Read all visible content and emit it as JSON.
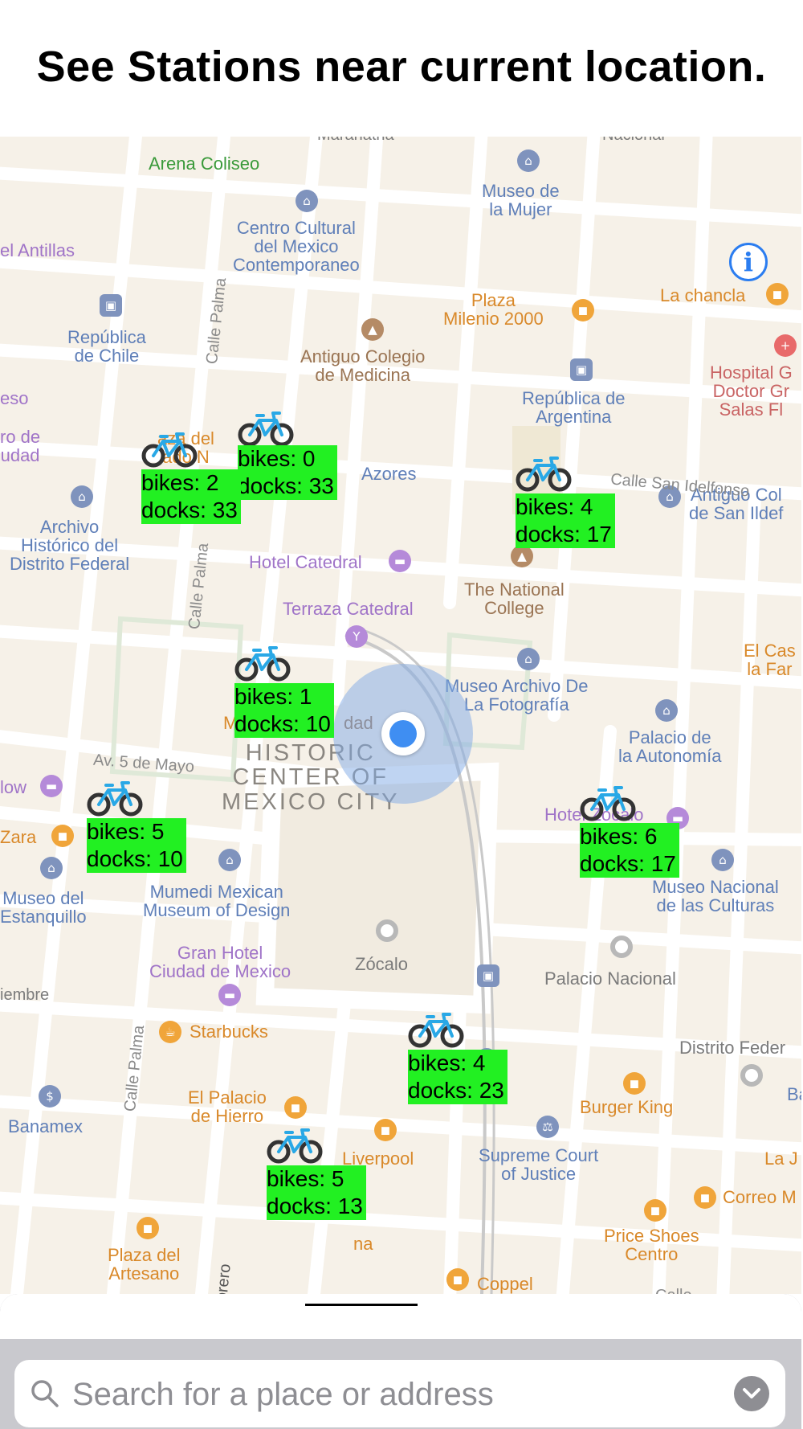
{
  "header": {
    "title": "See Stations near current location."
  },
  "map": {
    "district_label": "HISTORIC\nCENTER OF\nMEXICO CITY",
    "places": {
      "arena_coliseo": "Arena Coliseo",
      "museo_mujer": "Museo de\nla Mujer",
      "centro_cultural": "Centro Cultural\ndel Mexico\nContemporaneo",
      "el_antillas": "el Antillas",
      "la_chancla": "La chancla",
      "plaza_milenio": "Plaza\nMilenio 2000",
      "republica_chile": "República\nde Chile",
      "antiguo_colegio": "Antiguo Colegio\nde Medicina",
      "hospital": "Hospital G\nDoctor Gr\nSalas Fl",
      "republica_argentina": "República de\nArgentina",
      "eso": "eso",
      "ro_de_udad": "ro de\nudad",
      "plaza_del": "aza del\nado N",
      "azores": "Azores",
      "archivo_historico": "Archivo\nHistórico del\nDistrito Federal",
      "hotel_catedral": "Hotel Catedral",
      "national_college": "The National\nCollege",
      "antiguo_col_san": "Antiguo Col\nde San Ildef",
      "terraza_catedral": "Terraza Catedral",
      "el_cas": "El Cas\nla Far",
      "museo_fotografia": "Museo Archivo De\nLa Fotografía",
      "dad": "dad",
      "m": "M",
      "palacio_autonomia": "Palacio de\nla Autonomía",
      "low": "low",
      "zara": "Zara",
      "hotel_zocalo": "Hotel Zocalo",
      "museo_culturas": "Museo Nacional\nde las Culturas",
      "museo_estanquillo": "Museo del\nEstanquillo",
      "mumedi": "Mumedi Mexican\nMuseum of Design",
      "gran_hotel": "Gran Hotel\nCiudad de Mexico",
      "zocalo": "Zócalo",
      "palacio_nacional": "Palacio Nacional",
      "iembre": "iembre",
      "starbucks": "Starbucks",
      "distrito_feder": "Distrito Feder",
      "banamex": "Banamex",
      "el_palacio_hierro": "El Palacio\nde Hierro",
      "burger_king": "Burger King",
      "ba": "Ba",
      "liverpool": "Liverpool",
      "supreme_court": "Supreme Court\nof Justice",
      "la_j": "La J",
      "correo": "Correo M",
      "price_shoes": "Price Shoes\nCentro",
      "plaza_artesano": "Plaza del\nArtesano",
      "coppel": "Coppel",
      "na": "na",
      "maranatha": "Maranatha",
      "nacional": "Nacional"
    },
    "streets": {
      "calle_palma_1": "Calle Palma",
      "calle_palma_2": "Calle Palma",
      "calle_palma_3": "Calle Palma",
      "av_5_mayo": "Av. 5 de Mayo",
      "san_idelfonso": "Calle San Idelfonso",
      "obrero": "orero",
      "calle": "Calle"
    }
  },
  "stations": [
    {
      "bikes": "bikes: 0",
      "docks": "docks: 33"
    },
    {
      "bikes": "bikes: 2",
      "docks": "docks: 33"
    },
    {
      "bikes": "bikes: 4",
      "docks": "docks: 17"
    },
    {
      "bikes": "bikes: 1",
      "docks": "docks: 10"
    },
    {
      "bikes": "bikes: 5",
      "docks": "docks: 10"
    },
    {
      "bikes": "bikes: 6",
      "docks": "docks: 17"
    },
    {
      "bikes": "bikes: 4",
      "docks": "docks: 23"
    },
    {
      "bikes": "bikes: 5",
      "docks": "docks: 13"
    }
  ],
  "controls": {
    "info_icon": "i"
  },
  "search": {
    "placeholder": "Search for a place or address"
  },
  "icons": {
    "bike": "bicycle-icon",
    "search": "magnifier-icon",
    "dropdown": "chevron-down-icon",
    "info": "info-icon",
    "location": "current-location-icon"
  },
  "colors": {
    "station_label_bg": "#22f022",
    "location_dot": "#3f8ef2",
    "map_bg": "#f6f1e8"
  }
}
